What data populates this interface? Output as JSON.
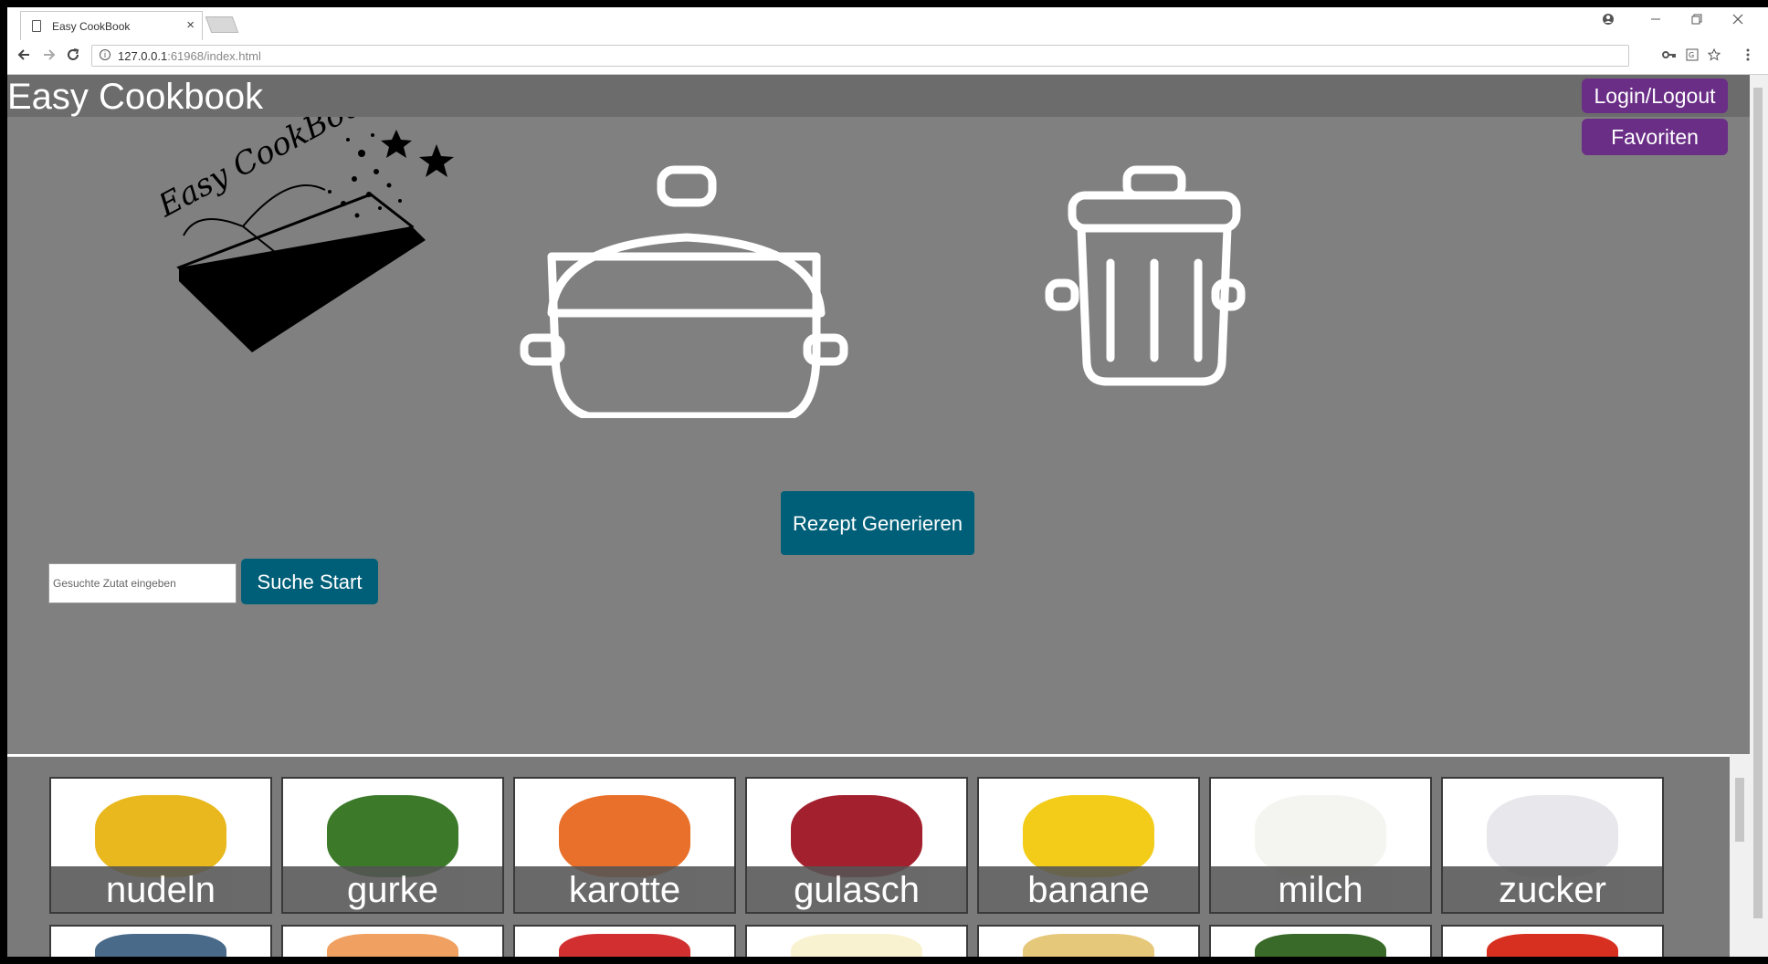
{
  "browser": {
    "tab_title": "Easy CookBook",
    "tab_close": "×",
    "url_host": "127.0.0.1",
    "url_rest": ":61968/index.html",
    "url_info": "i"
  },
  "header": {
    "title": "Easy Cookbook",
    "login_label": "Login/Logout",
    "favorites_label": "Favoriten"
  },
  "main": {
    "generate_label": "Rezept Generieren",
    "search_placeholder": "Gesuchte Zutat eingeben",
    "search_button": "Suche Start",
    "logo_text": "Easy CookBook"
  },
  "ingredients": [
    {
      "name": "nudeln",
      "color": "#e8b81e"
    },
    {
      "name": "gurke",
      "color": "#3c7a2a"
    },
    {
      "name": "karotte",
      "color": "#e8702a"
    },
    {
      "name": "gulasch",
      "color": "#a3202e"
    },
    {
      "name": "banane",
      "color": "#f2cc18"
    },
    {
      "name": "milch",
      "color": "#f4f4f0"
    },
    {
      "name": "zucker",
      "color": "#e8e8ec"
    }
  ],
  "ingredients_row2": [
    {
      "color": "#4a6a8a"
    },
    {
      "color": "#f0a060"
    },
    {
      "color": "#d23030"
    },
    {
      "color": "#f8f2d0"
    },
    {
      "color": "#e6c87a"
    },
    {
      "color": "#3a6a2a"
    },
    {
      "color": "#d83020"
    }
  ]
}
